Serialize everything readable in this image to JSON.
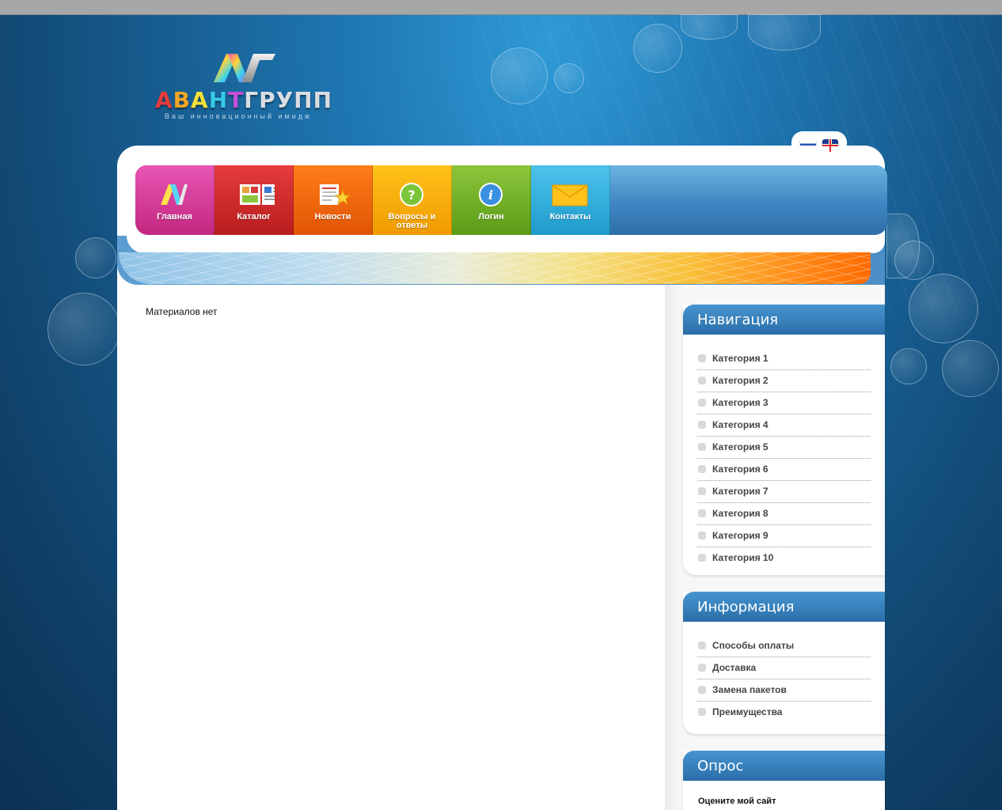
{
  "logo": {
    "name_parts": [
      "А",
      "В",
      "А",
      "Н",
      "Т",
      "ГРУПП"
    ],
    "tagline": "Ваш инновационный имидж"
  },
  "languages": [
    {
      "code": "ru",
      "icon": "flag-russia-icon"
    },
    {
      "code": "en",
      "icon": "flag-uk-icon"
    }
  ],
  "menu": {
    "items": [
      {
        "label": "Главная",
        "icon": "logo-icon",
        "color": "#d63a98"
      },
      {
        "label": "Каталог",
        "icon": "catalog-icon",
        "color": "#d42e2e"
      },
      {
        "label": "Новости",
        "icon": "news-icon",
        "color": "#f26a0d"
      },
      {
        "label": "Вопросы и ответы",
        "icon": "question-icon",
        "color": "#f9ae0c"
      },
      {
        "label": "Логин",
        "icon": "info-icon",
        "color": "#74b02a"
      },
      {
        "label": "Контакты",
        "icon": "envelope-icon",
        "color": "#33afdc"
      }
    ]
  },
  "content": {
    "empty_message": "Материалов нет"
  },
  "sidebar": {
    "navigation": {
      "title": "Навигация",
      "items": [
        "Категория 1",
        "Категория 2",
        "Категория 3",
        "Категория 4",
        "Категория 5",
        "Категория 6",
        "Категория 7",
        "Категория 8",
        "Категория 9",
        "Категория 10"
      ]
    },
    "information": {
      "title": "Информация",
      "items": [
        "Способы оплаты",
        "Доставка",
        "Замена пакетов",
        "Преимущества"
      ]
    },
    "poll": {
      "title": "Опрос",
      "question": "Оцените мой сайт"
    }
  },
  "colors": {
    "background": "#175d90",
    "accent_blue": "#2a6ea8",
    "banner_orange": "#ff6a00"
  }
}
